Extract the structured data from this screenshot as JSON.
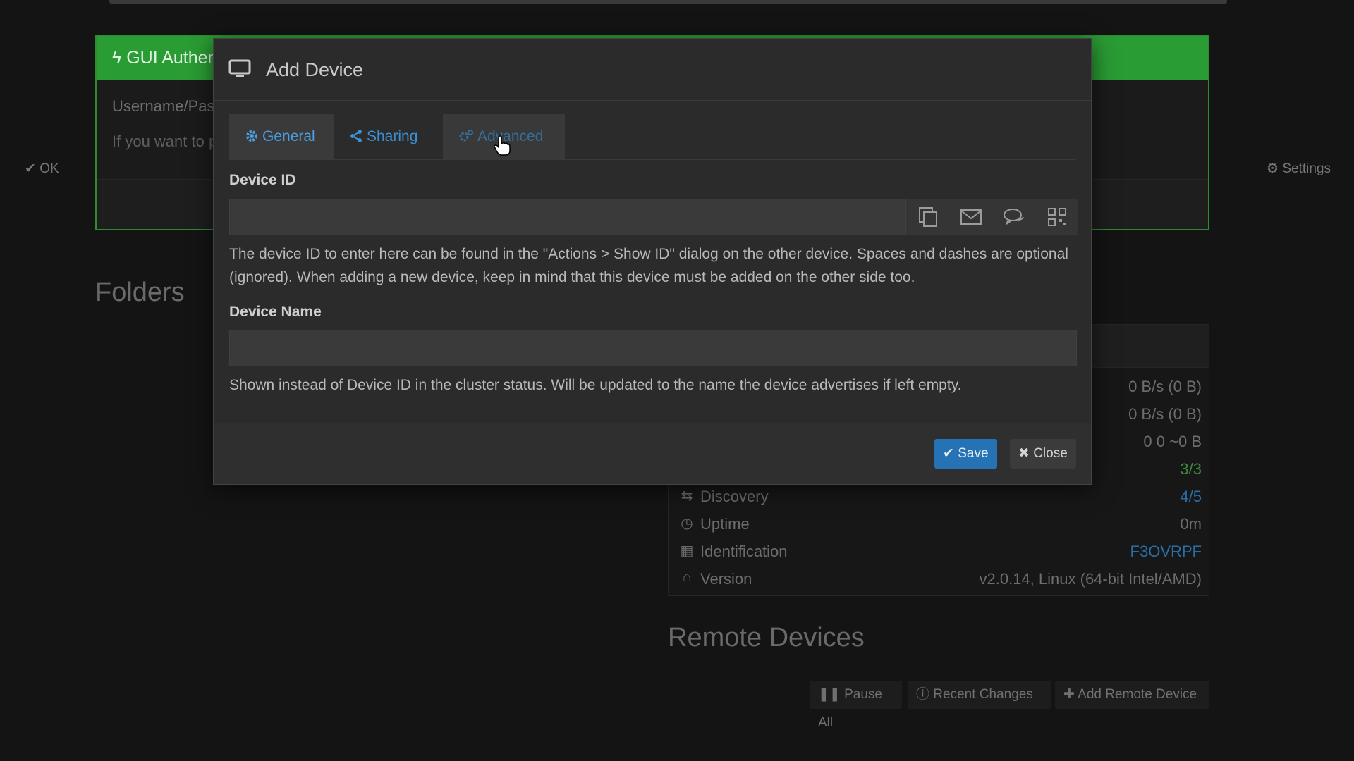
{
  "gui_auth": {
    "title": "GUI Authen",
    "line1": "Username/Pas",
    "line2": "If you want to p",
    "ok_label": "OK",
    "settings_label": "Settings"
  },
  "folders": {
    "title": "Folders"
  },
  "this_device": {
    "rows": [
      {
        "label": "",
        "value": "0 B/s (0 B)",
        "value_color": "plain"
      },
      {
        "label": "",
        "value": "0 B/s (0 B)",
        "value_color": "plain"
      },
      {
        "label": "",
        "value": "0   0   ~0 B",
        "value_color": "plain"
      },
      {
        "label": "",
        "value": "3/3",
        "value_color": "green"
      },
      {
        "label": "Discovery",
        "value": "4/5",
        "value_color": "blue"
      },
      {
        "label": "Uptime",
        "value": "0m",
        "value_color": "plain"
      },
      {
        "label": "Identification",
        "value": "F3OVRPF",
        "value_color": "blue"
      },
      {
        "label": "Version",
        "value": "v2.0.14, Linux (64-bit Intel/AMD)",
        "value_color": "plain"
      }
    ]
  },
  "remote_devices": {
    "title": "Remote Devices",
    "pause_all": "Pause All",
    "recent_changes": "Recent Changes",
    "add_remote": "Add Remote Device"
  },
  "modal": {
    "title": "Add Device",
    "tabs": [
      {
        "label": "General",
        "icon": "gear-icon",
        "state": "active"
      },
      {
        "label": "Sharing",
        "icon": "share-icon",
        "state": "normal"
      },
      {
        "label": "Advanced",
        "icon": "gears-icon",
        "state": "hover"
      }
    ],
    "device_id": {
      "label": "Device ID",
      "value": "",
      "placeholder": "",
      "help": "The device ID to enter here can be found in the \"Actions > Show ID\" dialog on the other device. Spaces and dashes are optional (ignored). When adding a new device, keep in mind that this device must be added on the other side too."
    },
    "device_name": {
      "label": "Device Name",
      "value": "",
      "placeholder": "",
      "help": "Shown instead of Device ID in the cluster status. Will be updated to the name the device advertises if left empty."
    },
    "save_label": "Save",
    "close_label": "Close"
  },
  "colors": {
    "accent": "#2572b4",
    "success": "#2a9c34",
    "link": "#3d8fd0"
  }
}
